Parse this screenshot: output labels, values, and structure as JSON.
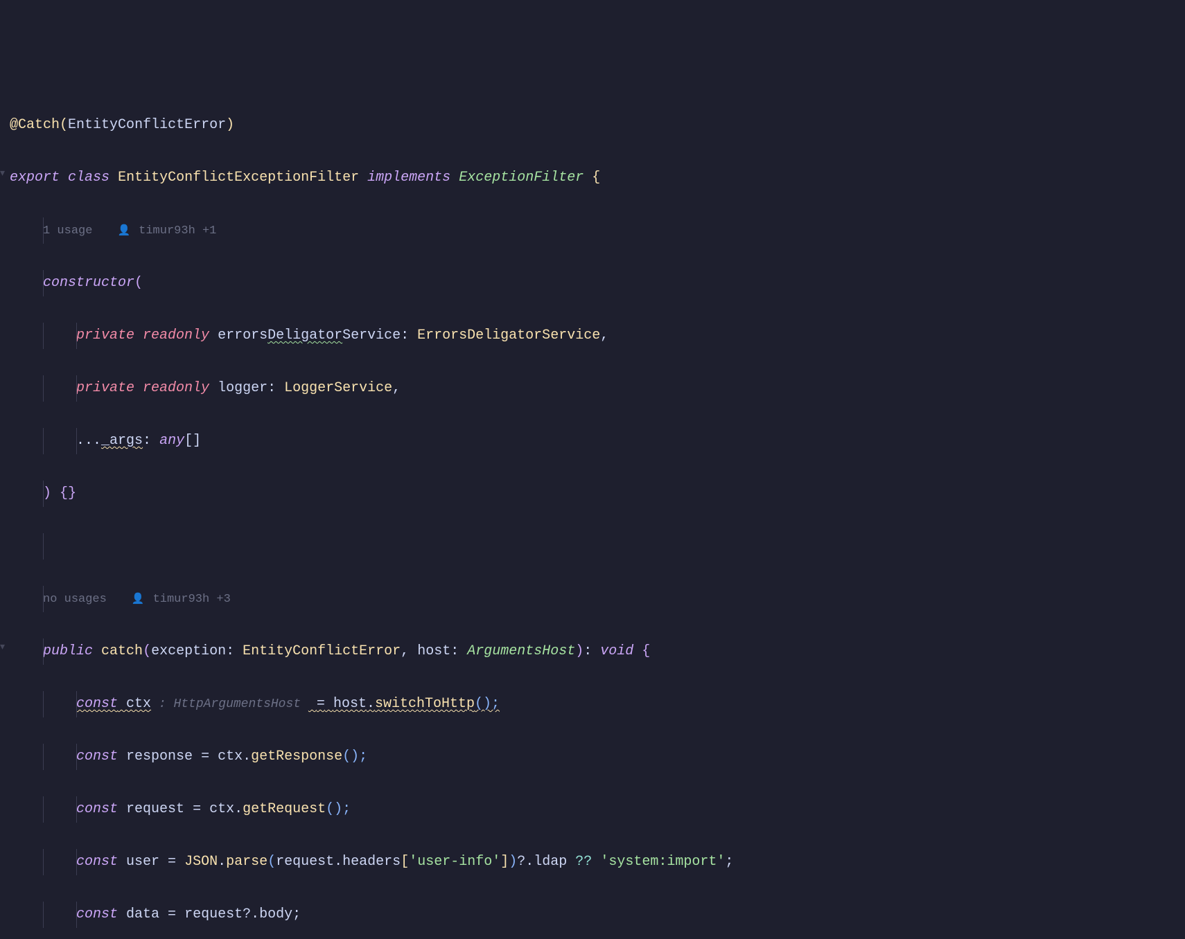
{
  "code": {
    "line1": {
      "decorator_at": "@",
      "decorator_name": "Catch",
      "paren_open": "(",
      "error_type": "EntityConflictError",
      "paren_close": ")"
    },
    "line2": {
      "export": "export",
      "class": "class",
      "class_name": "EntityConflictExceptionFilter",
      "implements": "implements",
      "interface": "ExceptionFilter",
      "brace": " {"
    },
    "line3_inlay": {
      "usage": "1 usage",
      "author": "timur93h +1"
    },
    "line4": {
      "constructor": "constructor",
      "paren": "("
    },
    "line5": {
      "private": "private",
      "readonly": "readonly",
      "param_name": "errors",
      "param_squiggle": "Deligator",
      "param_suffix": "Service",
      "colon": ": ",
      "type": "ErrorsDeligatorService",
      "comma": ","
    },
    "line6": {
      "private": "private",
      "readonly": "readonly",
      "param_name": "logger",
      "colon": ": ",
      "type": "LoggerService",
      "comma": ","
    },
    "line7": {
      "spread": "...",
      "param_squiggle": "_args",
      "colon": ": ",
      "type": "any",
      "brackets": "[]"
    },
    "line8": {
      "close": ") {}"
    },
    "line10_inlay": {
      "usage": "no usages",
      "author": "timur93h +3"
    },
    "line11": {
      "public": "public",
      "method": "catch",
      "paren_open": "(",
      "param1": "exception",
      "colon1": ": ",
      "type1": "EntityConflictError",
      "comma": ", ",
      "param2": "host",
      "colon2": ": ",
      "type2": "ArgumentsHost",
      "paren_close": ")",
      "return_colon": ": ",
      "return_type": "void",
      "brace": " {"
    },
    "line12": {
      "const": "const",
      "varname": " ctx",
      "inlay_type": " : HttpArgumentsHost ",
      "eq_sp": " ",
      "eq": "=",
      "sp": " ",
      "obj": "host",
      "dot": ".",
      "call": "switchToHttp",
      "parens": "();"
    },
    "line13": {
      "const": "const",
      "varname": " response ",
      "eq": "=",
      "sp": " ",
      "obj": "ctx",
      "dot": ".",
      "call": "getResponse",
      "parens": "();"
    },
    "line14": {
      "const": "const",
      "varname": " request ",
      "eq": "=",
      "sp": " ",
      "obj": "ctx",
      "dot": ".",
      "call": "getRequest",
      "parens": "();"
    },
    "line15": {
      "const": "const",
      "varname": " user ",
      "eq": "=",
      "sp": " ",
      "json": "JSON",
      "dot1": ".",
      "parse": "parse",
      "paren_open": "(",
      "req": "request",
      "dot2": ".",
      "headers": "headers",
      "bracket_open": "[",
      "header_key": "'user-info'",
      "bracket_close": "]",
      "paren_close": ")",
      "optchain": "?.",
      "ldap": "ldap ",
      "nullish": "??",
      "sp2": " ",
      "fallback": "'system:import'",
      "semi": ";"
    },
    "line16": {
      "const": "const",
      "varname": " data ",
      "eq": "=",
      "sp": " ",
      "req": "request",
      "optchain": "?.",
      "body": "body",
      "semi": ";"
    }
  }
}
